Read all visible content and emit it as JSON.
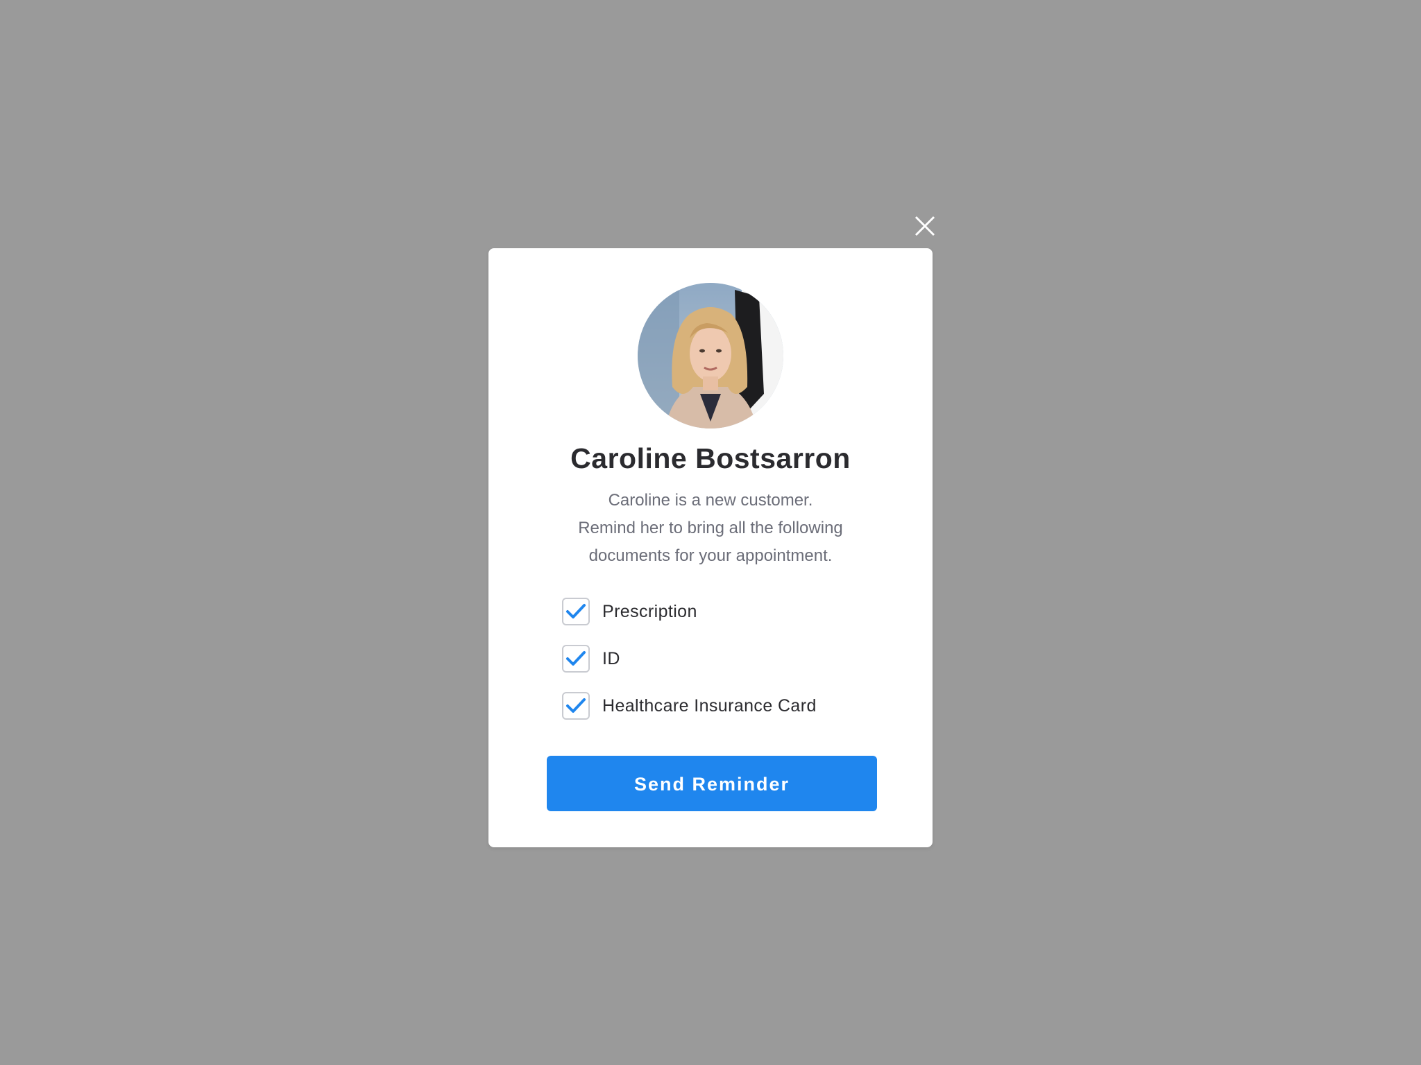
{
  "colors": {
    "backdrop": "#9a9a9a",
    "modal_bg": "#ffffff",
    "accent": "#1f86ee",
    "name_text": "#2b2b2f",
    "body_text": "#6b6d78",
    "checkbox_border": "#c9cbd1"
  },
  "modal": {
    "close_icon": "close-icon",
    "avatar": "customer-photo",
    "customer_name": "Caroline Bostsarron",
    "description": [
      "Caroline is a new customer.",
      "Remind her to bring all the following",
      "documents for your appointment."
    ],
    "documents": [
      {
        "label": "Prescription",
        "checked": true,
        "icon": "checkmark-icon"
      },
      {
        "label": "ID",
        "checked": true,
        "icon": "checkmark-icon"
      },
      {
        "label": "Healthcare Insurance Card",
        "checked": true,
        "icon": "checkmark-icon"
      }
    ],
    "button_label": "Send Reminder"
  }
}
